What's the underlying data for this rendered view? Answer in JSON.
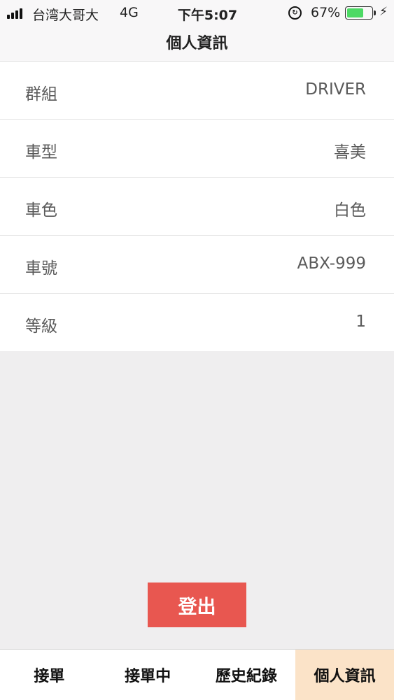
{
  "status_bar": {
    "carrier": "台湾大哥大",
    "network": "4G",
    "time": "下午5:07",
    "battery_percent": "67%",
    "battery_level": 0.67,
    "battery_color": "#4cd964"
  },
  "header": {
    "title": "個人資訊"
  },
  "info_rows": [
    {
      "label": "群組",
      "value": "DRIVER"
    },
    {
      "label": "車型",
      "value": "喜美"
    },
    {
      "label": "車色",
      "value": "白色"
    },
    {
      "label": "車號",
      "value": "ABX-999"
    },
    {
      "label": "等級",
      "value": "1"
    }
  ],
  "logout_button": {
    "label": "登出",
    "color": "#e85750"
  },
  "tabs": [
    {
      "label": "接單",
      "active": false
    },
    {
      "label": "接單中",
      "active": false
    },
    {
      "label": "歷史紀錄",
      "active": false
    },
    {
      "label": "個人資訊",
      "active": true
    }
  ],
  "colors": {
    "active_tab_bg": "#fbe3c8",
    "page_bg": "#efeeef"
  }
}
